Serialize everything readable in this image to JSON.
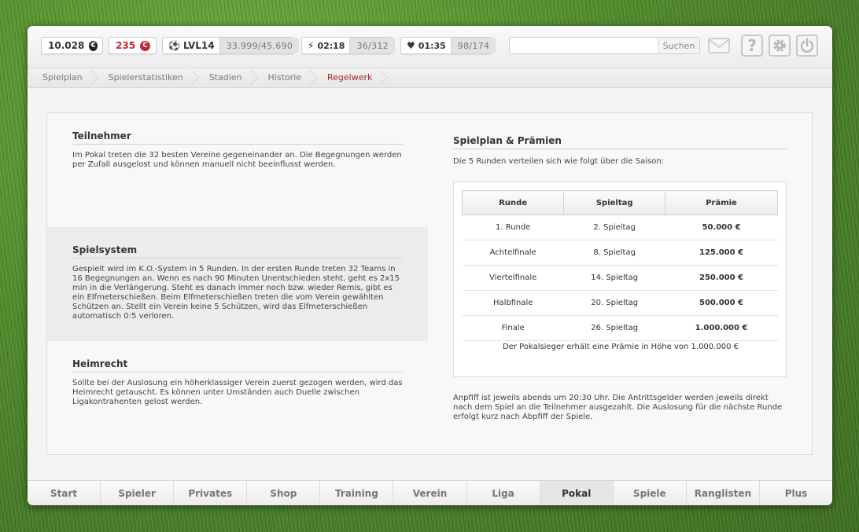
{
  "topbar": {
    "money": "10.028",
    "money_icon": "€",
    "credits": "235",
    "credits_icon": "C",
    "level": "LVL14",
    "xp": "33.999/45.690",
    "energy_time": "02:18",
    "energy": "36/312",
    "health_time": "01:35",
    "health": "98/174",
    "search_placeholder": "",
    "search_button": "Suchen",
    "help_label": "?"
  },
  "breadcrumbs": [
    "Spielplan",
    "Spielerstatistiken",
    "Stadien",
    "Historie",
    "Regelwerk"
  ],
  "left": {
    "sections": [
      {
        "title": "Teilnehmer",
        "text": "Im Pokal treten die 32 besten Vereine gegeneinander an. Die Begegnungen werden per Zufall ausgelost und können manuell nicht beeinflusst werden."
      },
      {
        "title": "Spielsystem",
        "text": "Gespielt wird im K.O.-System in 5 Runden. In der ersten Runde treten 32 Teams in 16 Begegnungen an. Wenn es nach 90 Minuten Unentschieden steht, geht es 2x15 min in die Verlängerung. Steht es danach immer noch bzw. wieder Remis, gibt es ein Elfmeterschießen. Beim Elfmeterschießen treten die vom Verein gewählten Schützen an. Stellt ein Verein keine 5 Schützen, wird das Elfmeterschießen automatisch 0:5 verloren."
      },
      {
        "title": "Heimrecht",
        "text": "Sollte bei der Auslosung ein höherklassiger Verein zuerst gezogen werden, wird das Heimrecht getauscht. Es können unter Umständen auch Duelle zwischen Ligakontrahenten gelost werden."
      }
    ]
  },
  "right": {
    "title": "Spielplan & Prämien",
    "intro": "Die 5 Runden verteilen sich wie folgt über die Saison:",
    "table": {
      "headers": [
        "Runde",
        "Spieltag",
        "Prämie"
      ],
      "rows": [
        [
          "1. Runde",
          "2. Spieltag",
          "50.000 €"
        ],
        [
          "Achtelfinale",
          "8. Spieltag",
          "125.000 €"
        ],
        [
          "Viertelfinale",
          "14. Spieltag",
          "250.000 €"
        ],
        [
          "Halbfinale",
          "20. Spieltag",
          "500.000 €"
        ],
        [
          "Finale",
          "26. Spieltag",
          "1.000.000 €"
        ]
      ]
    },
    "winner_note": "Der Pokalsieger erhält eine Prämie in Höhe von 1.000.000 €",
    "footer": "Anpfiff ist jeweils abends um 20:30 Uhr. Die Antrittsgelder werden jeweils direkt nach dem Spiel an die Teilnehmer ausgezahlt. Die Auslosung für die nächste Runde erfolgt kurz nach Abpfiff der Spiele."
  },
  "bottomnav": [
    "Start",
    "Spieler",
    "Privates",
    "Shop",
    "Training",
    "Verein",
    "Liga",
    "Pokal",
    "Spiele",
    "Ranglisten",
    "Plus"
  ],
  "colors": {
    "accent_red": "#c0282d",
    "active_breadcrumb": "#a5282d"
  }
}
